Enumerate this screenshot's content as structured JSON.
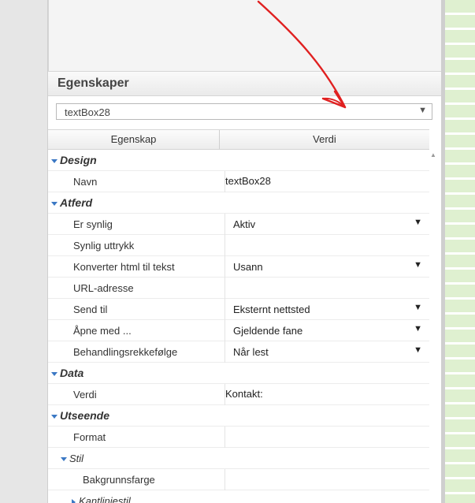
{
  "properties": {
    "title": "Egenskaper",
    "selected_object": "textBox28",
    "columns": {
      "property": "Egenskap",
      "value": "Verdi"
    },
    "categories": [
      {
        "name": "Design",
        "rows": [
          {
            "label": "Navn",
            "value": "textBox28",
            "kind": "text"
          }
        ]
      },
      {
        "name": "Atferd",
        "rows": [
          {
            "label": "Er synlig",
            "value": "Aktiv",
            "kind": "dropdown"
          },
          {
            "label": "Synlig uttrykk",
            "value": "",
            "kind": "text"
          },
          {
            "label": "Konverter html til tekst",
            "value": "Usann",
            "kind": "dropdown"
          },
          {
            "label": "URL-adresse",
            "value": "",
            "kind": "text"
          },
          {
            "label": "Send til",
            "value": "Eksternt nettsted",
            "kind": "dropdown"
          },
          {
            "label": "Åpne med ...",
            "value": "Gjeldende fane",
            "kind": "dropdown"
          },
          {
            "label": "Behandlingsrekkefølge",
            "value": "Når lest",
            "kind": "dropdown"
          }
        ]
      },
      {
        "name": "Data",
        "rows": [
          {
            "label": "Verdi",
            "value": "Kontakt:",
            "kind": "text"
          }
        ]
      },
      {
        "name": "Utseende",
        "rows": [
          {
            "label": "Format",
            "value": "",
            "kind": "text"
          }
        ]
      }
    ],
    "sub_group_stil": "Stil",
    "stil_row": {
      "label": "Bakgrunnsfarge",
      "value": ""
    },
    "collapsed_group": "Kantlinjestil"
  },
  "icons": {
    "expanded": "triangle-down-icon",
    "collapsed": "triangle-right-icon",
    "dropdown": "dropdown-arrow-icon"
  },
  "colors": {
    "accent": "#3b78c4",
    "annotation": "#e02020"
  }
}
